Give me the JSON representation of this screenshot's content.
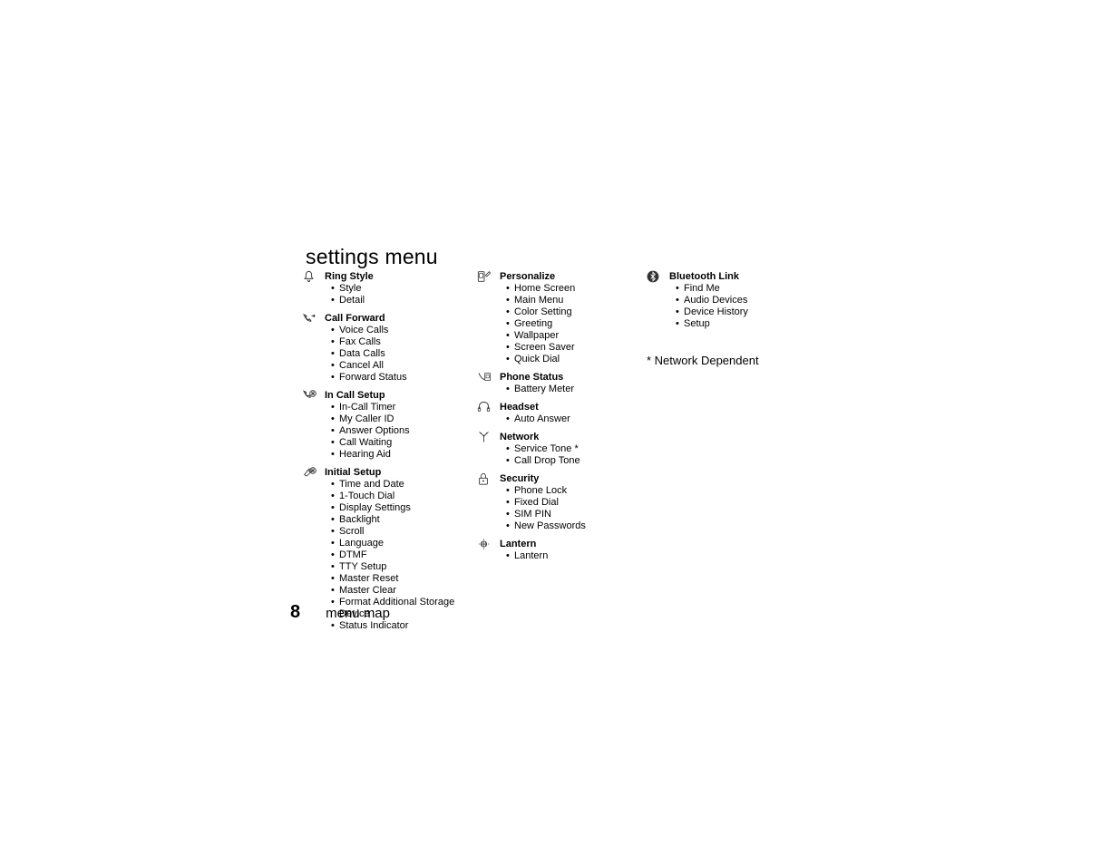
{
  "title": "settings menu",
  "columns": [
    [
      {
        "icon": "ring-style-icon",
        "heading": "Ring Style",
        "items": [
          "Style",
          "Detail"
        ]
      },
      {
        "icon": "call-forward-icon",
        "heading": "Call Forward",
        "items": [
          "Voice Calls",
          "Fax Calls",
          "Data Calls",
          "Cancel All",
          "Forward Status"
        ]
      },
      {
        "icon": "in-call-setup-icon",
        "heading": "In Call Setup",
        "items": [
          "In-Call Timer",
          "My Caller ID",
          "Answer Options",
          "Call Waiting",
          "Hearing Aid"
        ]
      },
      {
        "icon": "initial-setup-icon",
        "heading": "Initial Setup",
        "items": [
          "Time and Date",
          "1-Touch Dial",
          "Display Settings",
          "Backlight",
          "Scroll",
          "Language",
          "DTMF",
          "TTY Setup",
          "Master Reset",
          "Master Clear",
          "Format Additional Storage Device",
          "Status Indicator"
        ]
      }
    ],
    [
      {
        "icon": "personalize-icon",
        "heading": "Personalize",
        "items": [
          "Home Screen",
          "Main Menu",
          "Color Setting",
          "Greeting",
          "Wallpaper",
          "Screen Saver",
          "Quick Dial"
        ]
      },
      {
        "icon": "phone-status-icon",
        "heading": "Phone Status",
        "items": [
          "Battery Meter"
        ]
      },
      {
        "icon": "headset-icon",
        "heading": "Headset",
        "items": [
          "Auto Answer"
        ]
      },
      {
        "icon": "network-icon",
        "heading": "Network",
        "items": [
          "Service Tone *",
          "Call Drop Tone"
        ]
      },
      {
        "icon": "security-icon",
        "heading": "Security",
        "items": [
          "Phone Lock",
          "Fixed Dial",
          "SIM PIN",
          "New Passwords"
        ]
      },
      {
        "icon": "lantern-icon",
        "heading": "Lantern",
        "items": [
          "Lantern"
        ]
      }
    ],
    [
      {
        "icon": "bluetooth-icon",
        "heading": "Bluetooth Link",
        "items": [
          "Find Me",
          "Audio Devices",
          "Device History",
          "Setup"
        ]
      }
    ]
  ],
  "footnote": "* Network Dependent",
  "footer": {
    "page_number": "8",
    "label": "menu map"
  }
}
